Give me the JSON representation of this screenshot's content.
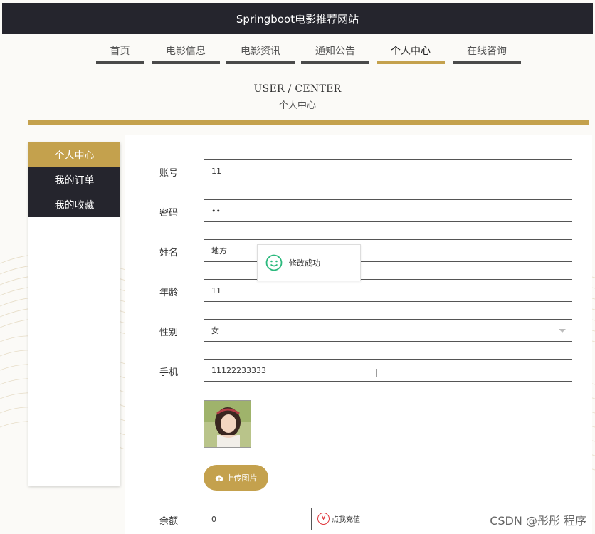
{
  "site": {
    "title": "Springboot电影推荐网站"
  },
  "nav": {
    "items": [
      {
        "label": "首页"
      },
      {
        "label": "电影信息"
      },
      {
        "label": "电影资讯"
      },
      {
        "label": "通知公告"
      },
      {
        "label": "个人中心"
      },
      {
        "label": "在线咨询"
      }
    ],
    "active_index": 4
  },
  "page_heading": {
    "en": "USER / CENTER",
    "zh": "个人中心"
  },
  "sidebar": {
    "items": [
      {
        "label": "个人中心"
      },
      {
        "label": "我的订单"
      },
      {
        "label": "我的收藏"
      }
    ],
    "active_index": 0
  },
  "form": {
    "account": {
      "label": "账号",
      "value": "11"
    },
    "password": {
      "label": "密码",
      "value": "••"
    },
    "name": {
      "label": "姓名",
      "value": "地方"
    },
    "age": {
      "label": "年龄",
      "value": "11"
    },
    "gender": {
      "label": "性别",
      "value": "女"
    },
    "phone": {
      "label": "手机",
      "value": "11122233333"
    },
    "upload_label": "上传图片",
    "balance": {
      "label": "余额",
      "value": "0"
    },
    "recharge_label": "点我充值",
    "recharge_icon": "¥"
  },
  "toast": {
    "message": "修改成功",
    "icon": "smile-icon"
  },
  "watermark": "CSDN @彤彤 程序",
  "colors": {
    "gold": "#c4a14d",
    "dark": "#25252d",
    "toast_icon": "#2bb97d",
    "recharge": "#e0393e"
  }
}
